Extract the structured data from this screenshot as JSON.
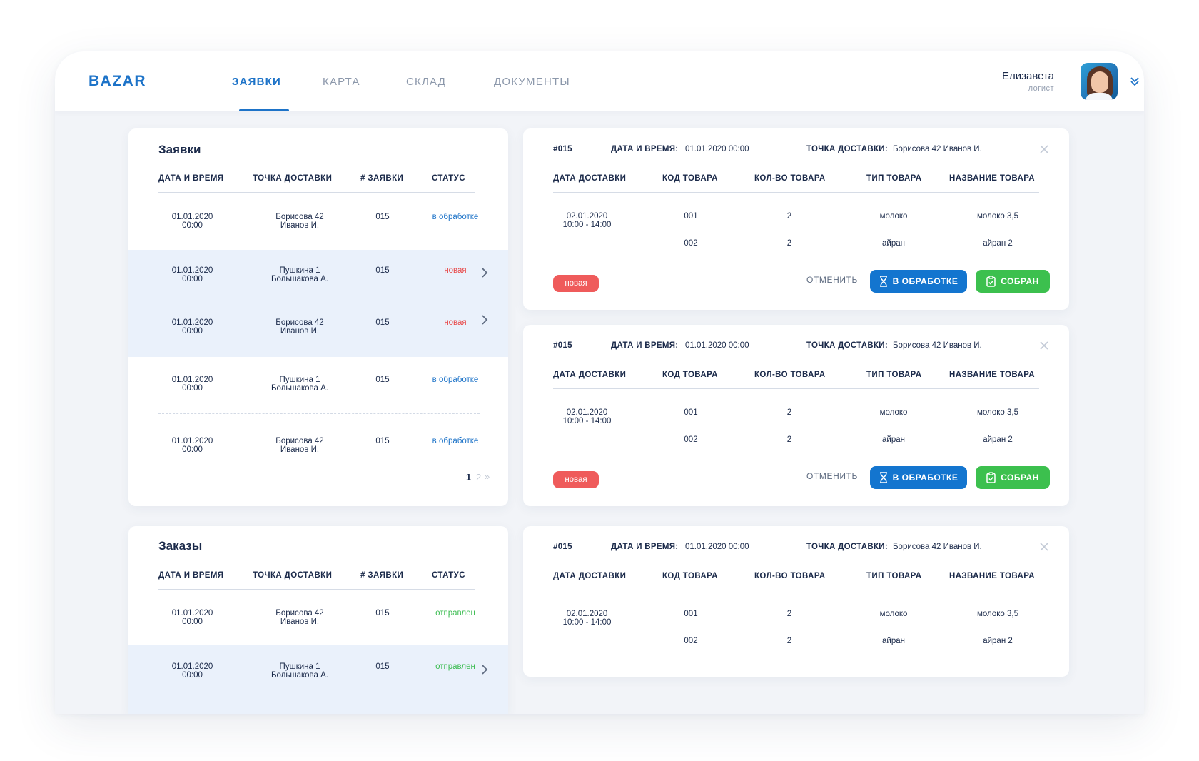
{
  "header": {
    "logo": "BAZAR",
    "tabs": [
      {
        "label": "ЗАЯВКИ",
        "active": true
      },
      {
        "label": "КАРТА",
        "active": false
      },
      {
        "label": "СКЛАД",
        "active": false
      },
      {
        "label": "ДОКУМЕНТЫ",
        "active": false
      }
    ],
    "user": {
      "name": "Елизавета",
      "role": "логист"
    }
  },
  "requests": {
    "title": "Заявки",
    "columns": [
      "ДАТА И ВРЕМЯ",
      "ТОЧКА ДОСТАВКИ",
      "# ЗАЯВКИ",
      "СТАТУС"
    ],
    "rows": [
      {
        "datetime": "01.01.2020\n00:00",
        "point": "Борисова 42\nИванов И.",
        "number": "015",
        "status": "в обработке"
      },
      {
        "datetime": "01.01.2020\n00:00",
        "point": "Пушкина 1\nБольшакова А.",
        "number": "015",
        "status": "новая"
      },
      {
        "datetime": "01.01.2020\n00:00",
        "point": "Борисова 42\nИванов И.",
        "number": "015",
        "status": "новая"
      },
      {
        "datetime": "01.01.2020\n00:00",
        "point": "Пушкина 1\nБольшакова А.",
        "number": "015",
        "status": "в обработке"
      },
      {
        "datetime": "01.01.2020\n00:00",
        "point": "Борисова 42\nИванов И.",
        "number": "015",
        "status": "в обработке"
      }
    ],
    "pager": {
      "current": "1",
      "next": "2",
      "more": "»"
    }
  },
  "orders": {
    "title": "Заказы",
    "columns": [
      "ДАТА И ВРЕМЯ",
      "ТОЧКА ДОСТАВКИ",
      "# ЗАЯВКИ",
      "СТАТУС"
    ],
    "rows": [
      {
        "datetime": "01.01.2020\n00:00",
        "point": "Борисова 42\nИванов И.",
        "number": "015",
        "status": "отправлен"
      },
      {
        "datetime": "01.01.2020\n00:00",
        "point": "Пушкина 1\nБольшакова А.",
        "number": "015",
        "status": "отправлен"
      }
    ]
  },
  "details": [
    {
      "number": "#015",
      "date_label": "ДАТА И ВРЕМЯ:",
      "date_value": "01.01.2020 00:00",
      "point_label": "ТОЧКА ДОСТАВКИ:",
      "point_value": "Борисова 42 Иванов И.",
      "columns": [
        "ДАТА ДОСТАВКИ",
        "КОД ТОВАРА",
        "КОЛ-ВО ТОВАРА",
        "ТИП ТОВАРА",
        "НАЗВАНИЕ ТОВАРА"
      ],
      "delivery": "02.01.2020\n10:00 - 14:00",
      "items": [
        {
          "code": "001",
          "qty": "2",
          "type": "молоко",
          "name": "молоко 3,5"
        },
        {
          "code": "002",
          "qty": "2",
          "type": "айран",
          "name": "айран 2"
        }
      ],
      "badge": "новая",
      "cancel": "ОТМЕНИТЬ",
      "processing": "В ОБРАБОТКЕ",
      "collected": "СОБРАН"
    },
    {
      "number": "#015",
      "date_label": "ДАТА И ВРЕМЯ:",
      "date_value": "01.01.2020 00:00",
      "point_label": "ТОЧКА ДОСТАВКИ:",
      "point_value": "Борисова 42 Иванов И.",
      "columns": [
        "ДАТА ДОСТАВКИ",
        "КОД ТОВАРА",
        "КОЛ-ВО ТОВАРА",
        "ТИП ТОВАРА",
        "НАЗВАНИЕ ТОВАРА"
      ],
      "delivery": "02.01.2020\n10:00 - 14:00",
      "items": [
        {
          "code": "001",
          "qty": "2",
          "type": "молоко",
          "name": "молоко 3,5"
        },
        {
          "code": "002",
          "qty": "2",
          "type": "айран",
          "name": "айран 2"
        }
      ],
      "badge": "новая",
      "cancel": "ОТМЕНИТЬ",
      "processing": "В ОБРАБОТКЕ",
      "collected": "СОБРАН"
    },
    {
      "number": "#015",
      "date_label": "ДАТА И ВРЕМЯ:",
      "date_value": "01.01.2020 00:00",
      "point_label": "ТОЧКА ДОСТАВКИ:",
      "point_value": "Борисова 42 Иванов И.",
      "columns": [
        "ДАТА ДОСТАВКИ",
        "КОД ТОВАРА",
        "КОЛ-ВО ТОВАРА",
        "ТИП ТОВАРА",
        "НАЗВАНИЕ ТОВАРА"
      ],
      "delivery": "02.01.2020\n10:00 - 14:00",
      "items": [
        {
          "code": "001",
          "qty": "2",
          "type": "молоко",
          "name": "молоко 3,5"
        },
        {
          "code": "002",
          "qty": "2",
          "type": "айран",
          "name": "айран 2"
        }
      ]
    }
  ],
  "icons": {
    "row_arrow": "chevron-right-icon",
    "close": "close-icon",
    "processing": "hourglass-icon",
    "collected": "clipboard-check-icon",
    "user_menu": "double-chevron-down-icon"
  },
  "colors": {
    "accent": "#1d73c8",
    "status_processing": "#1d73c8",
    "status_new": "#e84a4a",
    "status_sent": "#3ebd53",
    "button_processing": "#1375cf",
    "button_collected": "#3cc04e",
    "badge_new": "#ef5b5b",
    "row_highlight": "#eaf1fb"
  }
}
